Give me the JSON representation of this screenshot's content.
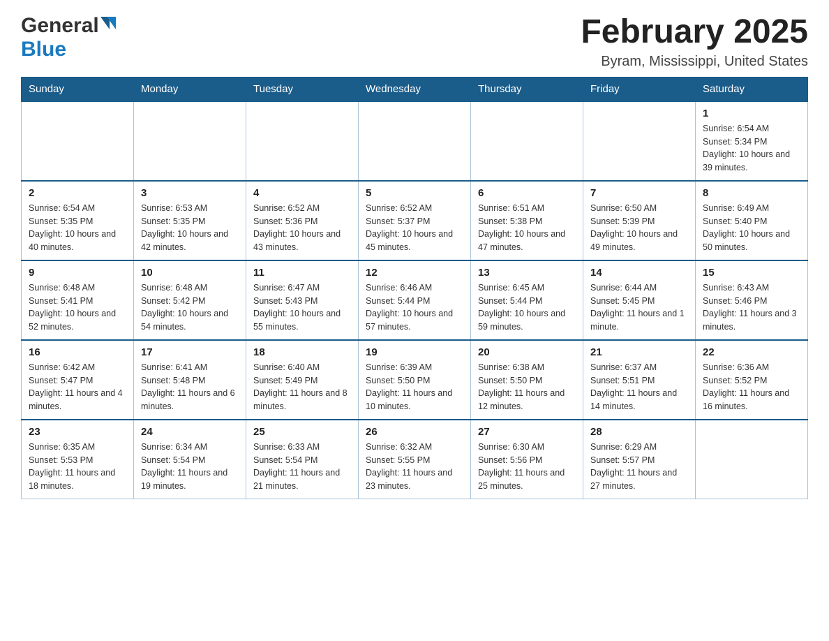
{
  "header": {
    "logo_general": "General",
    "logo_blue": "Blue",
    "title": "February 2025",
    "location": "Byram, Mississippi, United States"
  },
  "days_of_week": [
    "Sunday",
    "Monday",
    "Tuesday",
    "Wednesday",
    "Thursday",
    "Friday",
    "Saturday"
  ],
  "weeks": [
    {
      "days": [
        {
          "num": "",
          "info": ""
        },
        {
          "num": "",
          "info": ""
        },
        {
          "num": "",
          "info": ""
        },
        {
          "num": "",
          "info": ""
        },
        {
          "num": "",
          "info": ""
        },
        {
          "num": "",
          "info": ""
        },
        {
          "num": "1",
          "info": "Sunrise: 6:54 AM\nSunset: 5:34 PM\nDaylight: 10 hours\nand 39 minutes."
        }
      ]
    },
    {
      "days": [
        {
          "num": "2",
          "info": "Sunrise: 6:54 AM\nSunset: 5:35 PM\nDaylight: 10 hours\nand 40 minutes."
        },
        {
          "num": "3",
          "info": "Sunrise: 6:53 AM\nSunset: 5:35 PM\nDaylight: 10 hours\nand 42 minutes."
        },
        {
          "num": "4",
          "info": "Sunrise: 6:52 AM\nSunset: 5:36 PM\nDaylight: 10 hours\nand 43 minutes."
        },
        {
          "num": "5",
          "info": "Sunrise: 6:52 AM\nSunset: 5:37 PM\nDaylight: 10 hours\nand 45 minutes."
        },
        {
          "num": "6",
          "info": "Sunrise: 6:51 AM\nSunset: 5:38 PM\nDaylight: 10 hours\nand 47 minutes."
        },
        {
          "num": "7",
          "info": "Sunrise: 6:50 AM\nSunset: 5:39 PM\nDaylight: 10 hours\nand 49 minutes."
        },
        {
          "num": "8",
          "info": "Sunrise: 6:49 AM\nSunset: 5:40 PM\nDaylight: 10 hours\nand 50 minutes."
        }
      ]
    },
    {
      "days": [
        {
          "num": "9",
          "info": "Sunrise: 6:48 AM\nSunset: 5:41 PM\nDaylight: 10 hours\nand 52 minutes."
        },
        {
          "num": "10",
          "info": "Sunrise: 6:48 AM\nSunset: 5:42 PM\nDaylight: 10 hours\nand 54 minutes."
        },
        {
          "num": "11",
          "info": "Sunrise: 6:47 AM\nSunset: 5:43 PM\nDaylight: 10 hours\nand 55 minutes."
        },
        {
          "num": "12",
          "info": "Sunrise: 6:46 AM\nSunset: 5:44 PM\nDaylight: 10 hours\nand 57 minutes."
        },
        {
          "num": "13",
          "info": "Sunrise: 6:45 AM\nSunset: 5:44 PM\nDaylight: 10 hours\nand 59 minutes."
        },
        {
          "num": "14",
          "info": "Sunrise: 6:44 AM\nSunset: 5:45 PM\nDaylight: 11 hours\nand 1 minute."
        },
        {
          "num": "15",
          "info": "Sunrise: 6:43 AM\nSunset: 5:46 PM\nDaylight: 11 hours\nand 3 minutes."
        }
      ]
    },
    {
      "days": [
        {
          "num": "16",
          "info": "Sunrise: 6:42 AM\nSunset: 5:47 PM\nDaylight: 11 hours\nand 4 minutes."
        },
        {
          "num": "17",
          "info": "Sunrise: 6:41 AM\nSunset: 5:48 PM\nDaylight: 11 hours\nand 6 minutes."
        },
        {
          "num": "18",
          "info": "Sunrise: 6:40 AM\nSunset: 5:49 PM\nDaylight: 11 hours\nand 8 minutes."
        },
        {
          "num": "19",
          "info": "Sunrise: 6:39 AM\nSunset: 5:50 PM\nDaylight: 11 hours\nand 10 minutes."
        },
        {
          "num": "20",
          "info": "Sunrise: 6:38 AM\nSunset: 5:50 PM\nDaylight: 11 hours\nand 12 minutes."
        },
        {
          "num": "21",
          "info": "Sunrise: 6:37 AM\nSunset: 5:51 PM\nDaylight: 11 hours\nand 14 minutes."
        },
        {
          "num": "22",
          "info": "Sunrise: 6:36 AM\nSunset: 5:52 PM\nDaylight: 11 hours\nand 16 minutes."
        }
      ]
    },
    {
      "days": [
        {
          "num": "23",
          "info": "Sunrise: 6:35 AM\nSunset: 5:53 PM\nDaylight: 11 hours\nand 18 minutes."
        },
        {
          "num": "24",
          "info": "Sunrise: 6:34 AM\nSunset: 5:54 PM\nDaylight: 11 hours\nand 19 minutes."
        },
        {
          "num": "25",
          "info": "Sunrise: 6:33 AM\nSunset: 5:54 PM\nDaylight: 11 hours\nand 21 minutes."
        },
        {
          "num": "26",
          "info": "Sunrise: 6:32 AM\nSunset: 5:55 PM\nDaylight: 11 hours\nand 23 minutes."
        },
        {
          "num": "27",
          "info": "Sunrise: 6:30 AM\nSunset: 5:56 PM\nDaylight: 11 hours\nand 25 minutes."
        },
        {
          "num": "28",
          "info": "Sunrise: 6:29 AM\nSunset: 5:57 PM\nDaylight: 11 hours\nand 27 minutes."
        },
        {
          "num": "",
          "info": ""
        }
      ]
    }
  ]
}
